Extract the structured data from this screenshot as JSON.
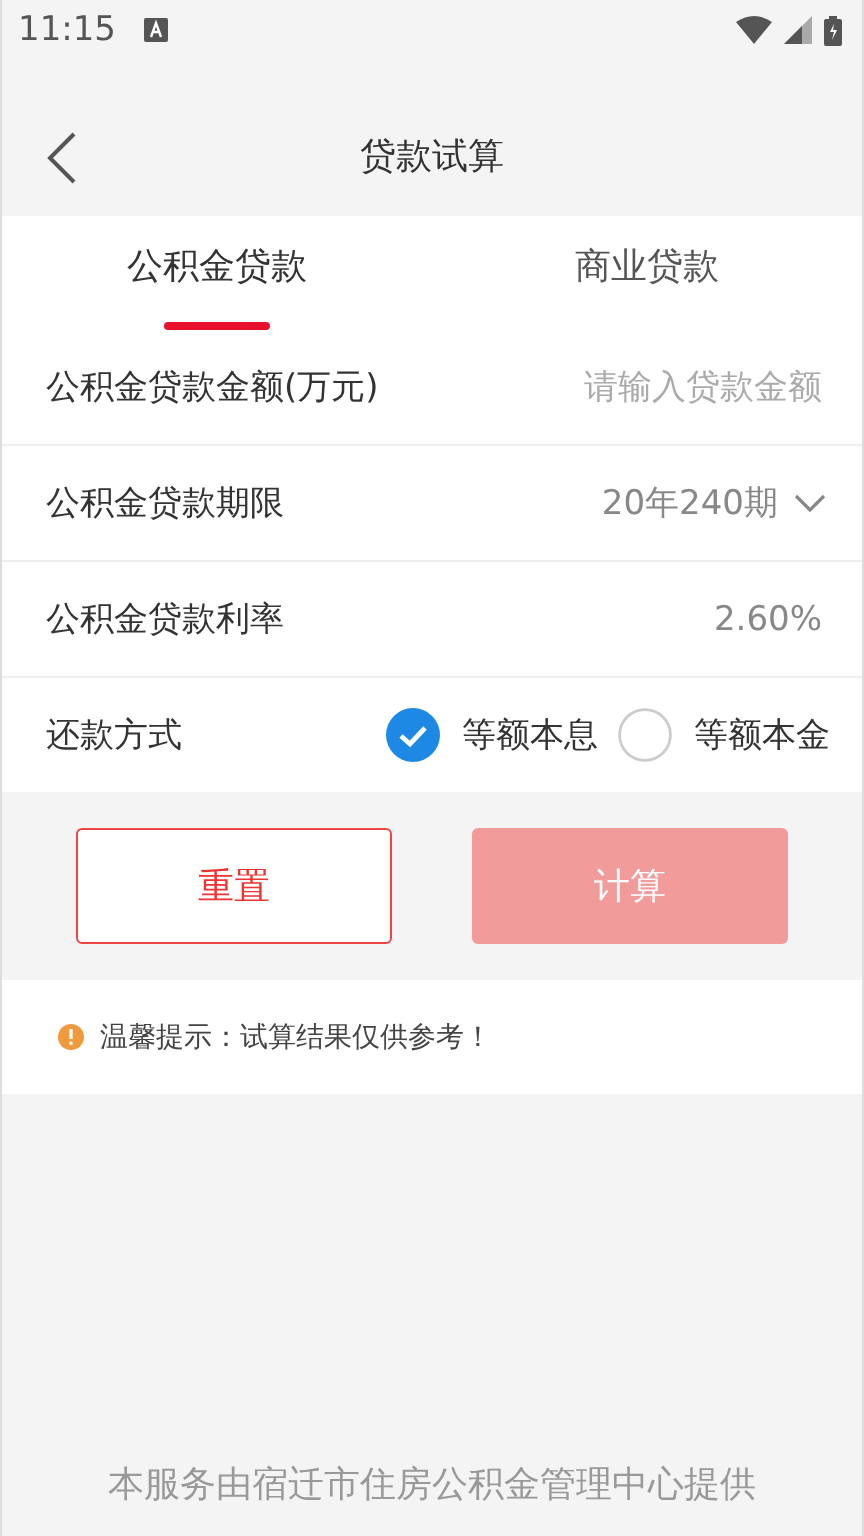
{
  "status_bar": {
    "time": "11:15"
  },
  "header": {
    "title": "贷款试算"
  },
  "tabs": [
    {
      "label": "公积金贷款",
      "selected": true
    },
    {
      "label": "商业贷款",
      "selected": false
    }
  ],
  "form": [
    {
      "kind": "input",
      "label": "公积金贷款金额(万元)",
      "placeholder": "请输入贷款金额"
    },
    {
      "kind": "select",
      "label": "公积金贷款期限",
      "value": "20年240期"
    },
    {
      "kind": "text",
      "label": "公积金贷款利率",
      "value": "2.60%"
    },
    {
      "kind": "radio",
      "label": "还款方式",
      "options": [
        {
          "label": "等额本息",
          "selected": true
        },
        {
          "label": "等额本金",
          "selected": false
        }
      ]
    }
  ],
  "buttons": [
    {
      "label": "重置",
      "kind": "outline",
      "disabled": false
    },
    {
      "label": "计算",
      "kind": "primary",
      "disabled": true
    }
  ],
  "tip": "温馨提示：试算结果仅供参考！",
  "footer": "本服务由宿迁市住房公积金管理中心提供"
}
